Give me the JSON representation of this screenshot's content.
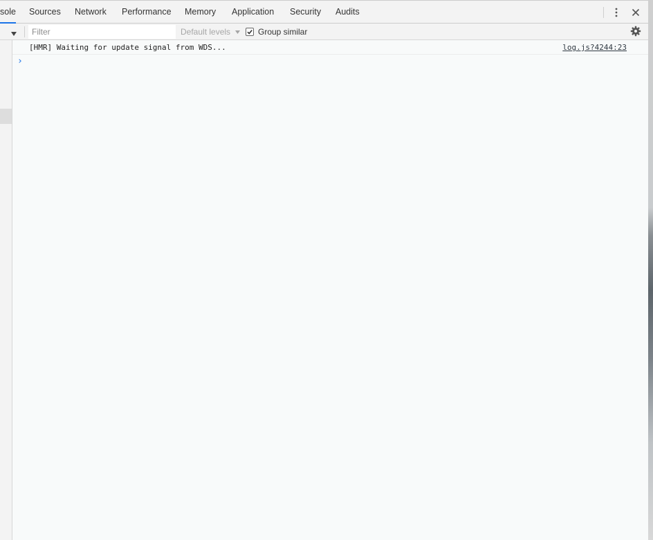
{
  "tabs": [
    {
      "label": "sole",
      "active": true
    },
    {
      "label": "Sources",
      "active": false
    },
    {
      "label": "Network",
      "active": false
    },
    {
      "label": "Performance",
      "active": false
    },
    {
      "label": "Memory",
      "active": false
    },
    {
      "label": "Application",
      "active": false
    },
    {
      "label": "Security",
      "active": false
    },
    {
      "label": "Audits",
      "active": false
    }
  ],
  "toolbar": {
    "filter_placeholder": "Filter",
    "filter_value": "",
    "levels_label": "Default levels",
    "group_similar_label": "Group similar",
    "group_similar_checked": true
  },
  "console": {
    "messages": [
      {
        "text": "[HMR] Waiting for update signal from WDS...",
        "source": "log.js?4244:23"
      }
    ],
    "prompt_symbol": "›"
  },
  "colors": {
    "accent": "#1a73e8",
    "toolbar_bg": "#f3f3f3",
    "console_bg": "#f8fafa"
  },
  "icons": [
    "context-dropdown-icon",
    "levels-dropdown-icon",
    "more-vert-icon",
    "close-icon",
    "settings-gear-icon"
  ]
}
